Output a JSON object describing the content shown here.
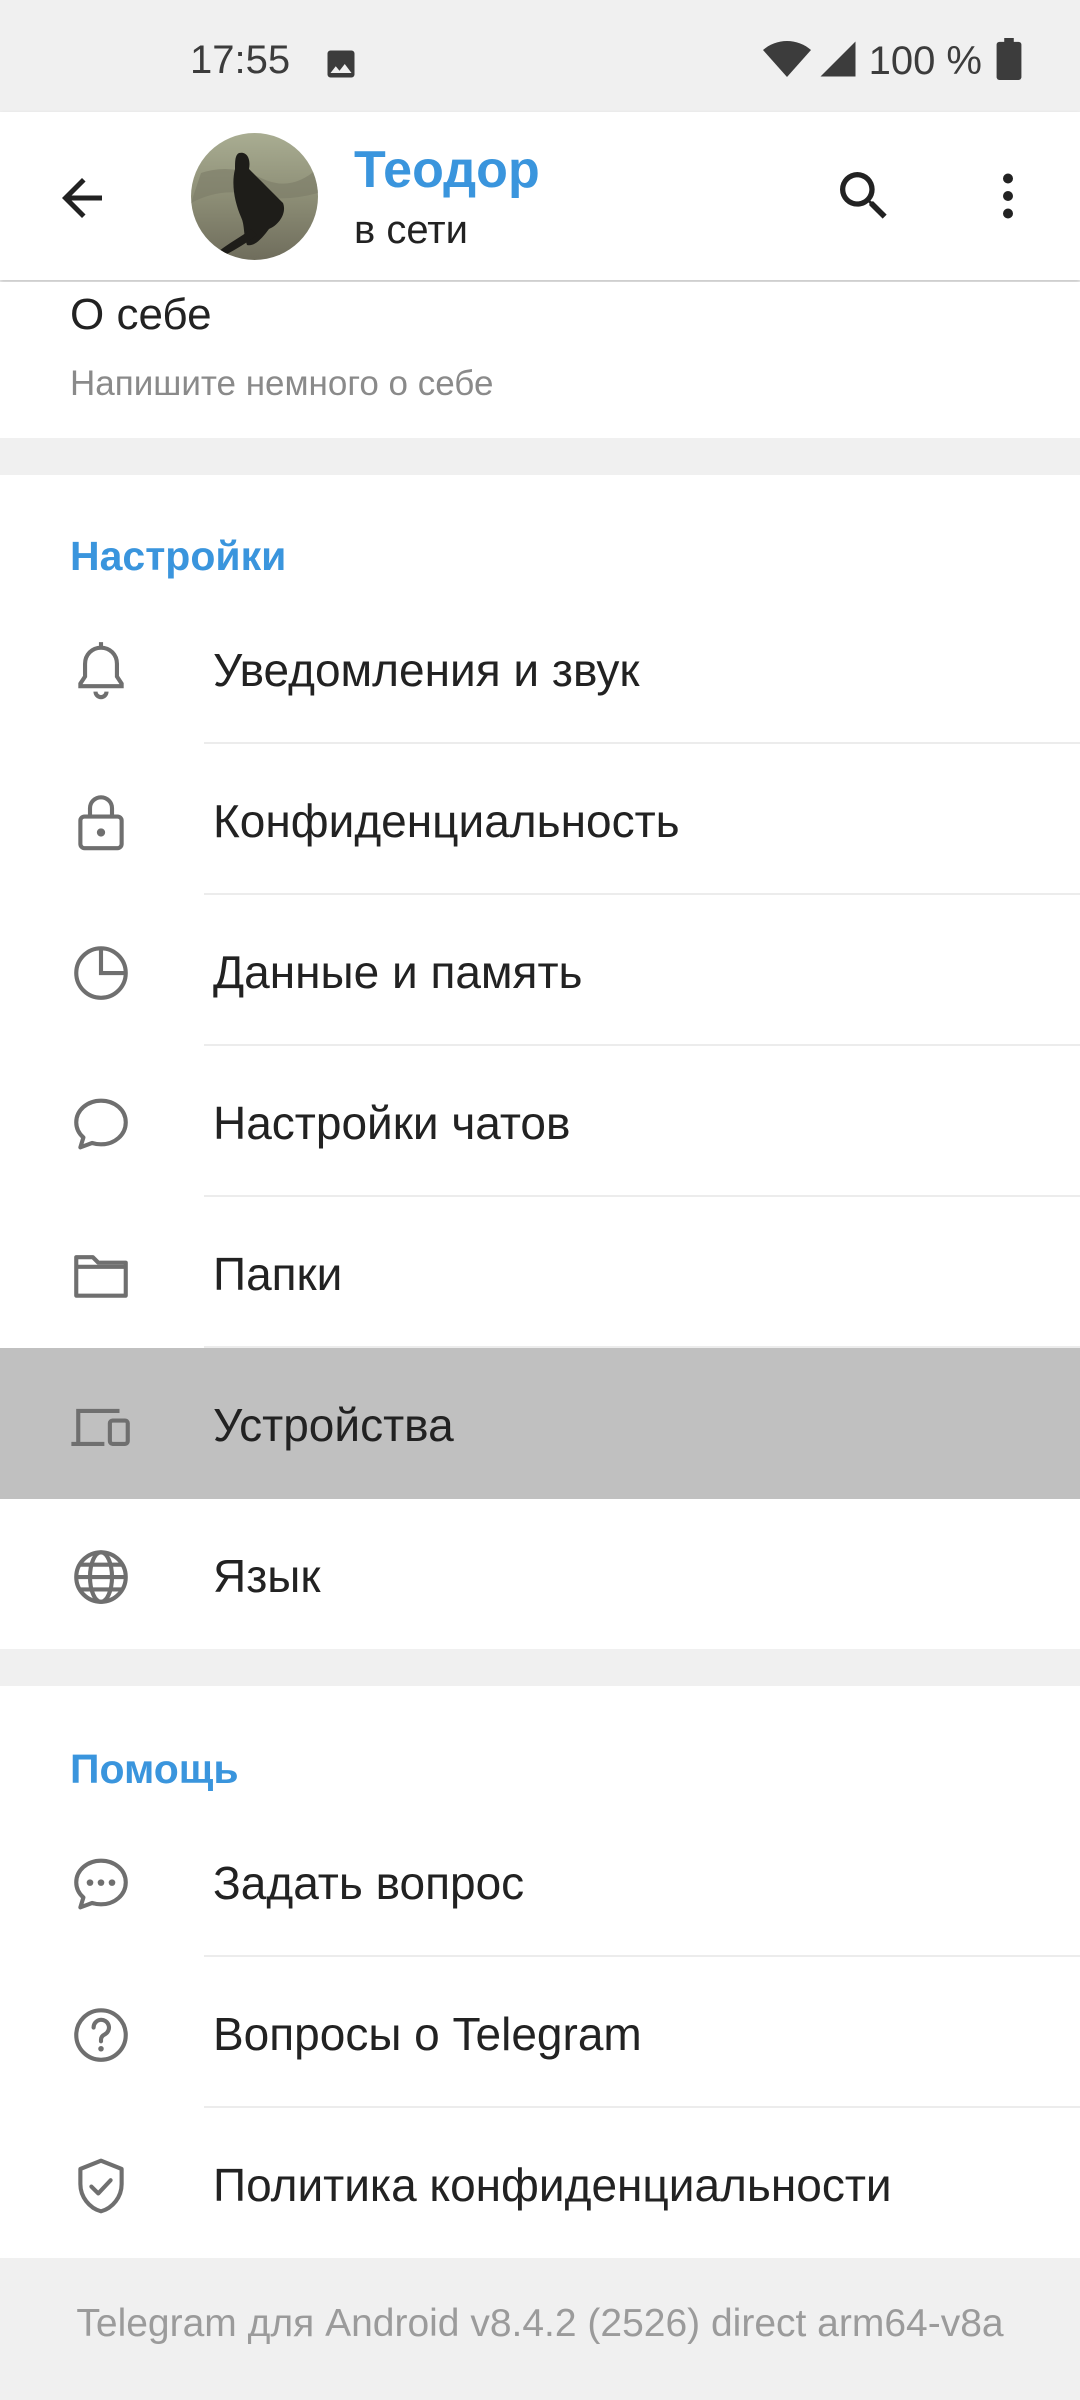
{
  "status_bar": {
    "time": "17:55",
    "battery_text": "100 %"
  },
  "header": {
    "name": "Теодор",
    "status": "в сети"
  },
  "about": {
    "title": "О себе",
    "hint": "Напишите немного о себе"
  },
  "settings": {
    "header": "Настройки",
    "items": [
      {
        "label": "Уведомления и звук",
        "icon": "bell-icon"
      },
      {
        "label": "Конфиденциальность",
        "icon": "lock-icon"
      },
      {
        "label": "Данные и память",
        "icon": "data-pie-icon"
      },
      {
        "label": "Настройки чатов",
        "icon": "chat-bubble-icon"
      },
      {
        "label": "Папки",
        "icon": "folder-icon"
      },
      {
        "label": "Устройства",
        "icon": "devices-icon"
      },
      {
        "label": "Язык",
        "icon": "globe-icon"
      }
    ]
  },
  "help": {
    "header": "Помощь",
    "items": [
      {
        "label": "Задать вопрос",
        "icon": "ask-question-icon"
      },
      {
        "label": "Вопросы о Telegram",
        "icon": "help-circle-icon"
      },
      {
        "label": "Политика конфиденциальности",
        "icon": "shield-check-icon"
      }
    ]
  },
  "footer": {
    "version": "Telegram для Android v8.4.2 (2526) direct arm64-v8a"
  },
  "colors": {
    "accent": "#3a95dd",
    "background": "#f0f0f0",
    "pressed_row": "#c0c0c0",
    "icon_gray": "#6f6f6f"
  }
}
